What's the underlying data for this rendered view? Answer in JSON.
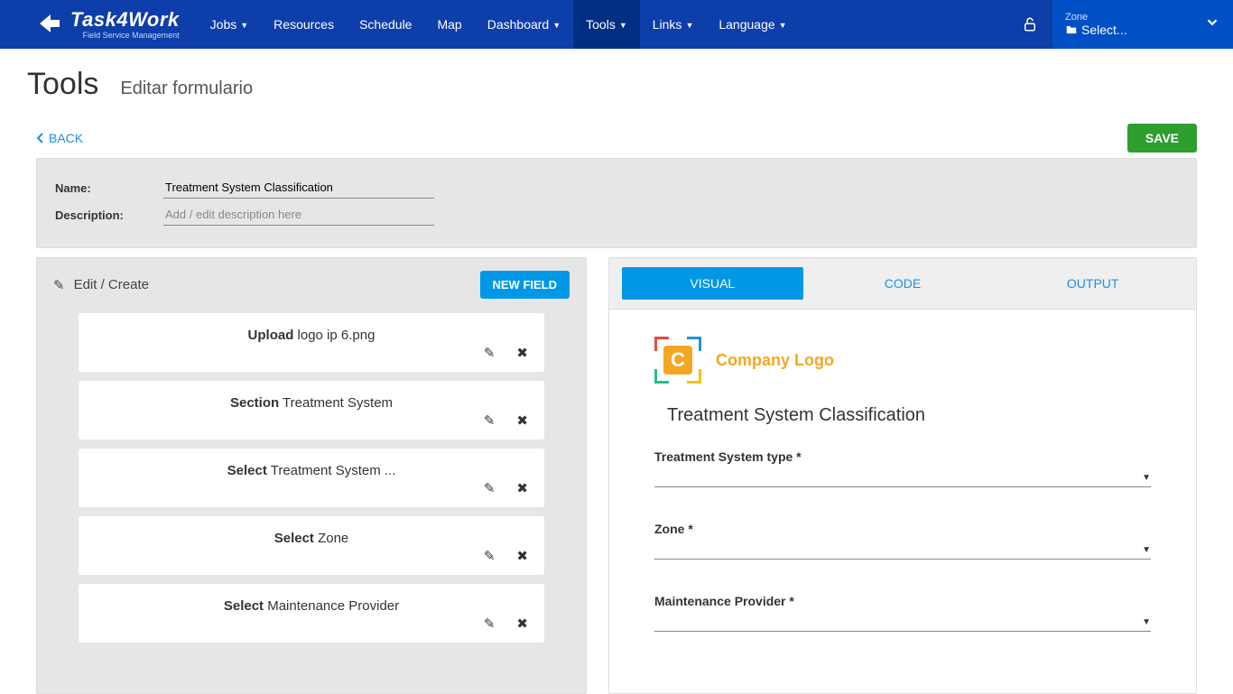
{
  "brand": {
    "name": "Task4Work",
    "tagline": "Field Service Management"
  },
  "nav": {
    "items": [
      {
        "label": "Jobs",
        "dropdown": true,
        "active": false
      },
      {
        "label": "Resources",
        "dropdown": false,
        "active": false
      },
      {
        "label": "Schedule",
        "dropdown": false,
        "active": false
      },
      {
        "label": "Map",
        "dropdown": false,
        "active": false
      },
      {
        "label": "Dashboard",
        "dropdown": true,
        "active": false
      },
      {
        "label": "Tools",
        "dropdown": true,
        "active": true
      },
      {
        "label": "Links",
        "dropdown": true,
        "active": false
      },
      {
        "label": "Language",
        "dropdown": true,
        "active": false
      }
    ],
    "zone_label": "Zone",
    "zone_value": "Select..."
  },
  "page": {
    "title": "Tools",
    "subtitle": "Editar formulario",
    "back": "BACK",
    "save": "SAVE"
  },
  "meta": {
    "name_label": "Name:",
    "name_value": "Treatment System Classification",
    "desc_label": "Description:",
    "desc_placeholder": "Add / edit description here"
  },
  "editor": {
    "heading": "Edit / Create",
    "new_field_btn": "NEW FIELD",
    "fields": [
      {
        "type": "Upload",
        "value": "logo ip 6.png"
      },
      {
        "type": "Section",
        "value": "Treatment System"
      },
      {
        "type": "Select",
        "value": "Treatment System ..."
      },
      {
        "type": "Select",
        "value": "Zone"
      },
      {
        "type": "Select",
        "value": "Maintenance Provider"
      }
    ]
  },
  "tabs": {
    "visual": "VISUAL",
    "code": "CODE",
    "output": "OUTPUT"
  },
  "preview": {
    "logo_text": "Company Logo",
    "form_title": "Treatment System Classification",
    "fields": [
      {
        "label": "Treatment System type",
        "required": true
      },
      {
        "label": "Zone",
        "required": true
      },
      {
        "label": "Maintenance Provider",
        "required": true
      }
    ]
  }
}
